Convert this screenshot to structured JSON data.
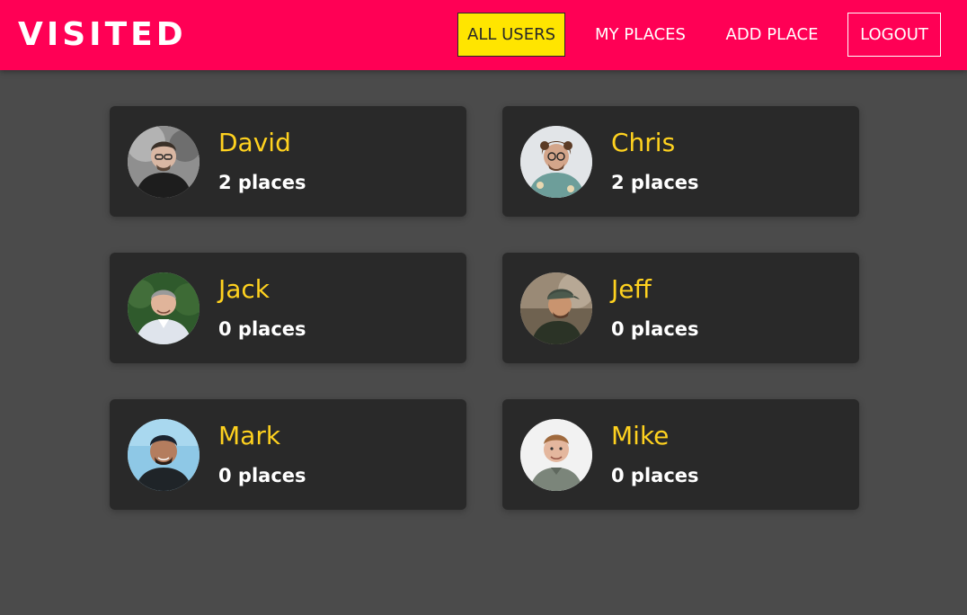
{
  "app": {
    "brand": "VISITED"
  },
  "nav": {
    "all_users": "ALL USERS",
    "my_places": "MY PLACES",
    "add_place": "ADD PLACE",
    "logout": "LOGOUT"
  },
  "colors": {
    "header": "#ff0055",
    "active_nav": "#ffe500",
    "page_background": "#4b4b4b",
    "card": "#292929",
    "user_name": "#ffd21f",
    "places_text": "#ffffff"
  },
  "users": [
    {
      "name": "David",
      "places": "2 places"
    },
    {
      "name": "Chris",
      "places": "2 places"
    },
    {
      "name": "Jack",
      "places": "0 places"
    },
    {
      "name": "Jeff",
      "places": "0 places"
    },
    {
      "name": "Mark",
      "places": "0 places"
    },
    {
      "name": "Mike",
      "places": "0 places"
    }
  ]
}
